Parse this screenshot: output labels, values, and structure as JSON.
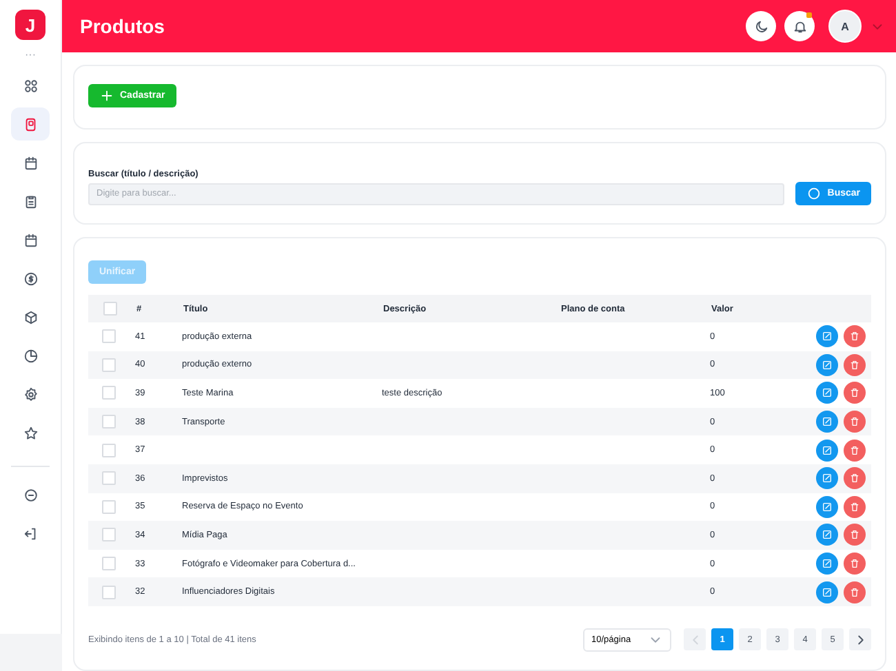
{
  "sidebar": {
    "logo": "J",
    "more": "···",
    "items": [
      {
        "selected": false
      },
      {
        "selected": true
      },
      {
        "selected": false
      },
      {
        "selected": false
      },
      {
        "selected": false
      },
      {
        "selected": false
      },
      {
        "selected": false
      },
      {
        "selected": false
      },
      {
        "selected": false
      },
      {
        "selected": false
      }
    ],
    "bottom_items": [
      {
        "selected": false
      },
      {
        "selected": false
      }
    ]
  },
  "header": {
    "title": "Produtos",
    "notification": true,
    "avatar": "A"
  },
  "actions": {
    "create_button": "Cadastrar"
  },
  "search": {
    "label": "Buscar (título / descrição)",
    "placeholder": "Digite para buscar...",
    "button": "Buscar"
  },
  "merge_button": {
    "label": "Unificar",
    "disabled": true
  },
  "table": {
    "all_checked": false,
    "columns": [
      "#",
      "Título",
      "Descrição",
      "Plano de conta",
      "Valor"
    ],
    "rows": [
      {
        "checked": false,
        "cells": [
          "41",
          "produção externa",
          "",
          "",
          "0"
        ]
      },
      {
        "checked": false,
        "cells": [
          "40",
          "produção externo",
          "",
          "",
          "0"
        ]
      },
      {
        "checked": false,
        "cells": [
          "39",
          "Teste Marina",
          "teste descrição",
          "",
          "100"
        ]
      },
      {
        "checked": false,
        "cells": [
          "38",
          "Transporte",
          "",
          "",
          "0"
        ]
      },
      {
        "checked": false,
        "cells": [
          "37",
          "",
          "",
          "",
          "0"
        ]
      },
      {
        "checked": false,
        "cells": [
          "36",
          "Imprevistos",
          "",
          "",
          "0"
        ]
      },
      {
        "checked": false,
        "cells": [
          "35",
          "Reserva de Espaço no Evento",
          "",
          "",
          "0"
        ]
      },
      {
        "checked": false,
        "cells": [
          "34",
          "Mídia Paga",
          "",
          "",
          "0"
        ]
      },
      {
        "checked": false,
        "cells": [
          "33",
          "Fotógrafo e Videomaker para Cobertura d...",
          "",
          "",
          "0"
        ]
      },
      {
        "checked": false,
        "cells": [
          "32",
          "Influenciadores Digitais",
          "",
          "",
          "0"
        ]
      }
    ]
  },
  "footer": {
    "summary": "Exibindo itens de 1 a 10 | Total de 41 itens",
    "page_size": "10/página",
    "prev_disabled": true,
    "next_disabled": false,
    "pages": [
      {
        "label": "1",
        "selected": true
      },
      {
        "label": "2",
        "selected": false
      },
      {
        "label": "3",
        "selected": false
      },
      {
        "label": "4",
        "selected": false
      },
      {
        "label": "5",
        "selected": false
      }
    ]
  }
}
